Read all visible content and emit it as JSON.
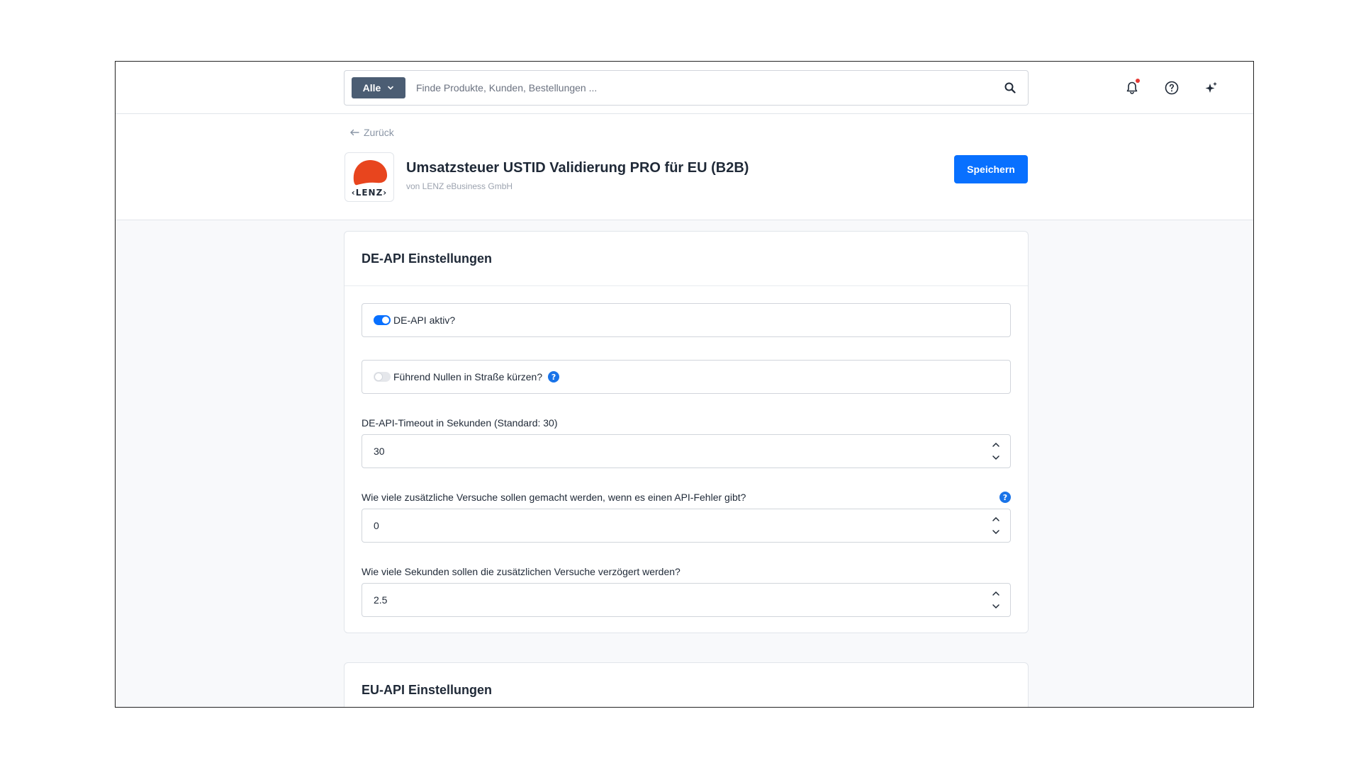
{
  "colors": {
    "accent": "#0870ff",
    "search_type_bg": "#4b5d73",
    "notification_dot": "#e53935",
    "logo_red": "#e8451e",
    "help_blue": "#1973e8"
  },
  "search": {
    "type_label": "Alle",
    "placeholder": "Finde Produkte, Kunden, Bestellungen ...",
    "value": ""
  },
  "topbar_icons": [
    "bell-icon",
    "help-circle-icon",
    "sparkles-icon"
  ],
  "header": {
    "back_label": "Zurück",
    "logo_text": "‹LENZ›",
    "title": "Umsatzsteuer USTID Validierung PRO für EU (B2B)",
    "subtitle": "von LENZ eBusiness GmbH",
    "save_label": "Speichern"
  },
  "de_api": {
    "title": "DE-API Einstellungen",
    "active": {
      "label": "DE-API aktiv?",
      "checked": true
    },
    "trim_zeros": {
      "label": "Führend Nullen in Straße kürzen?",
      "checked": false
    },
    "timeout": {
      "label": "DE-API-Timeout in Sekunden (Standard: 30)",
      "value": "30"
    },
    "retries": {
      "label": "Wie viele zusätzliche Versuche sollen gemacht werden, wenn es einen API-Fehler gibt?",
      "value": "0"
    },
    "delay": {
      "label": "Wie viele Sekunden sollen die zusätzlichen Versuche verzögert werden?",
      "value": "2.5"
    }
  },
  "eu_api": {
    "title": "EU-API Einstellungen"
  }
}
